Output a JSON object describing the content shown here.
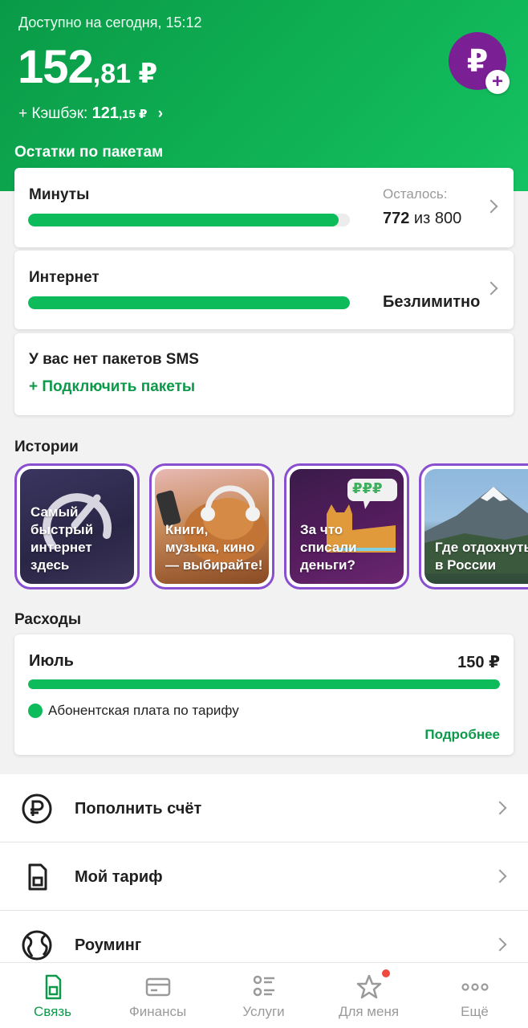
{
  "header": {
    "available_text": "Доступно на сегодня, 15:12",
    "balance_int": "152",
    "balance_frac": ",81 ₽",
    "cashback_prefix": "+ Кэшбэк: ",
    "cashback_int": "121",
    "cashback_frac": ",15 ₽",
    "cashback_chevron": "›",
    "avatar_symbol": "₽",
    "avatar_plus": "+"
  },
  "packages": {
    "title": "Остатки по пакетам",
    "minutes": {
      "label": "Минуты",
      "left_label": "Осталось:",
      "remaining": "772",
      "of_text": " из 800",
      "fill_fraction": 0.965
    },
    "internet": {
      "label": "Интернет",
      "value": "Безлимитно",
      "fill_fraction": 1.0
    },
    "sms": {
      "label": "У вас нет пакетов SMS",
      "connect_label": "+  Подключить пакеты"
    }
  },
  "stories": {
    "title": "Истории",
    "items": [
      {
        "text": "Самый\nбыстрый\nинтернет\nздесь"
      },
      {
        "text": "Книги,\nмузыка, кино\n— выбирайте!"
      },
      {
        "text": "За что\nсписали\nденьги?",
        "bubble": "₽₽₽"
      },
      {
        "text": "Где отдохнуть\nв России"
      }
    ]
  },
  "expenses": {
    "title": "Расходы",
    "month": "Июль",
    "sum": "150 ₽",
    "legend": "Абонентская плата по тарифу",
    "more_link": "Подробнее",
    "fill_fraction": 1.0
  },
  "menu": {
    "items": [
      {
        "label": "Пополнить счёт",
        "icon": "ruble-circle-icon"
      },
      {
        "label": "Мой тариф",
        "icon": "sim-card-icon"
      },
      {
        "label": "Роуминг",
        "icon": "globe-icon"
      }
    ]
  },
  "tabbar": {
    "items": [
      {
        "label": "Связь",
        "icon": "sim-icon",
        "active": true
      },
      {
        "label": "Финансы",
        "icon": "card-icon"
      },
      {
        "label": "Услуги",
        "icon": "list-icon"
      },
      {
        "label": "Для меня",
        "icon": "star-icon",
        "badge": true
      },
      {
        "label": "Ещё",
        "icon": "more-dots-icon"
      }
    ]
  },
  "colors": {
    "brand_green": "#0dbb5a",
    "avatar_purple": "#7b1f95",
    "story_border": "#8a4fd1",
    "badge_red": "#f0493e"
  }
}
